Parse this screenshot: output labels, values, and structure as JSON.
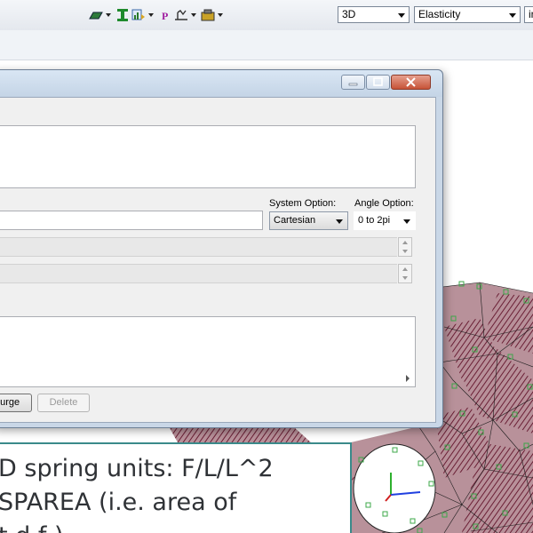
{
  "toolbar": {
    "icons": [
      "shell-icon",
      "beam-section-icon",
      "chart-icon",
      "property-icon",
      "spring-icon",
      "load-icon"
    ],
    "view_combo": "3D",
    "property_combo": "Elasticity",
    "units_combo": "in"
  },
  "dialog": {
    "system_option_label": "System Option:",
    "system_option_value": "Cartesian",
    "angle_option_label": "Angle Option:",
    "angle_option_value": "0 to 2pi",
    "purge_button": "Purge",
    "delete_button": "Delete"
  },
  "caption": {
    "line1": "D spring units: F/L/L^2",
    "line2": "SPAREA (i.e. area of",
    "line3": "t  d    f   )"
  },
  "colors": {
    "mesh_fill": "#b8919a",
    "mesh_dark": "#6a1f35",
    "mesh_line": "#1a1a1a",
    "node_marker": "#3da84a",
    "caption_border": "#3a8a8a"
  }
}
